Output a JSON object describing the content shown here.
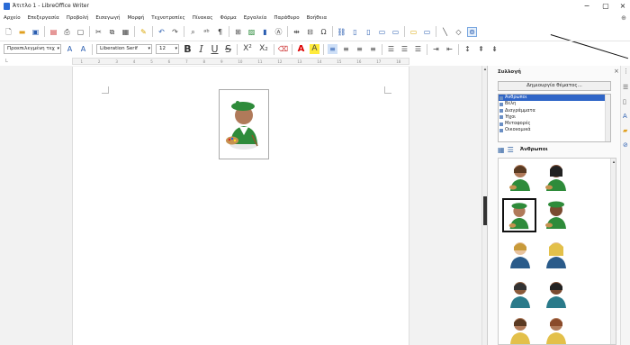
{
  "window": {
    "title": "Άτιτλο 1 - LibreOffice Writer",
    "minimize": "−",
    "maximize": "▢",
    "close": "×"
  },
  "menu": [
    "Αρχείο",
    "Επεξεργασία",
    "Προβολή",
    "Εισαγωγή",
    "Μορφή",
    "Τεχνοτροπίες",
    "Πίνακας",
    "Φόρμα",
    "Εργαλεία",
    "Παράθυρο",
    "Βοήθεια"
  ],
  "toolbar2": {
    "paragraph_style": "Προεπιλεγμένη τεχ",
    "font_name": "Liberation Serif",
    "font_size": "12",
    "bold": "B",
    "italic": "I",
    "underline": "U",
    "strike": "S",
    "superscript": "X²",
    "subscript": "X₂",
    "font_color": "A",
    "highlight": "A"
  },
  "ruler": [
    "1",
    "2",
    "3",
    "4",
    "5",
    "6",
    "7",
    "8",
    "9",
    "10",
    "11",
    "12",
    "13",
    "14",
    "15",
    "16",
    "17",
    "18"
  ],
  "sidebar": {
    "title": "Συλλογή",
    "close": "×",
    "new_theme_button": "Δημιουργία θέματος...",
    "themes": [
      "Άνθρωποι",
      "Βέλη",
      "Διαγράμματα",
      "Ήχοι",
      "Μεταφορές",
      "Οικονομικά"
    ],
    "selected_theme_index": 0,
    "current_theme_label": "Άνθρωποι"
  },
  "colors": {
    "accent": "#2f65c7",
    "shirt": "#2e8b3a",
    "hat": "#2e8b3a"
  }
}
